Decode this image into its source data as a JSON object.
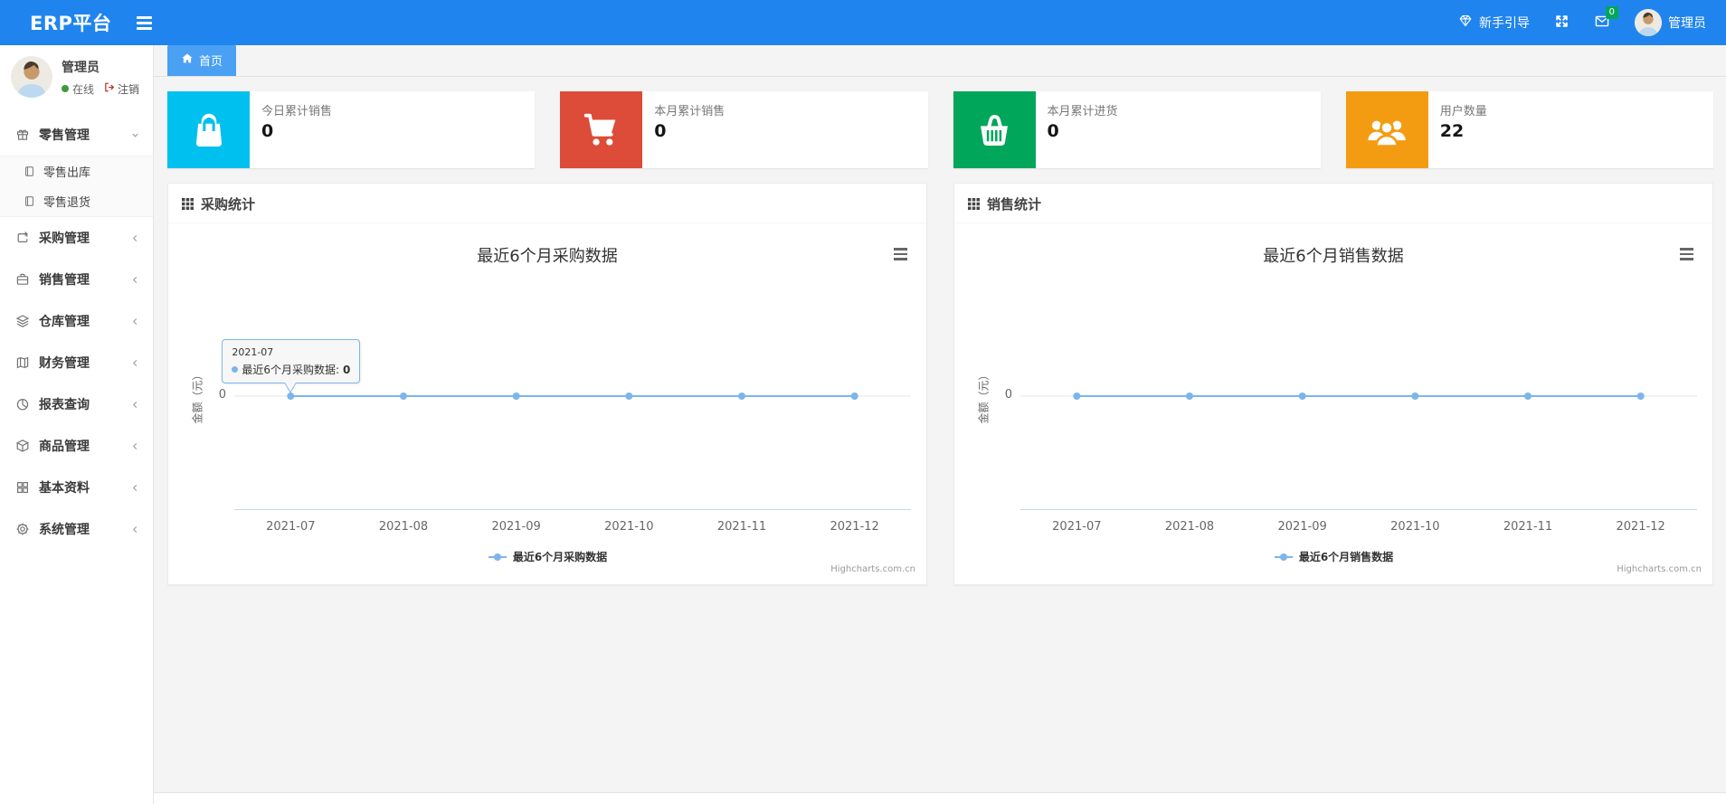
{
  "theme": {
    "navbar_bg": "#2084ef",
    "active_tab_bg": "#4aa0f2",
    "content_bg": "#f4f4f4"
  },
  "navbar": {
    "brand": "ERP平台",
    "guide_label": "新手引导",
    "messages_badge": "0",
    "user_name": "管理员"
  },
  "sidebar": {
    "user": {
      "name": "管理员",
      "status": "在线",
      "logout_label": "注销"
    },
    "items": [
      {
        "label": "零售管理",
        "children": [
          "零售出库",
          "零售退货"
        ]
      },
      {
        "label": "采购管理"
      },
      {
        "label": "销售管理"
      },
      {
        "label": "仓库管理"
      },
      {
        "label": "财务管理"
      },
      {
        "label": "报表查询"
      },
      {
        "label": "商品管理"
      },
      {
        "label": "基本资料"
      },
      {
        "label": "系统管理"
      }
    ]
  },
  "tabs": {
    "home": "首页"
  },
  "stats": [
    {
      "label": "今日累计销售",
      "value": "0",
      "color": "#00c0ef",
      "icon": "shopping-bag-icon"
    },
    {
      "label": "本月累计销售",
      "value": "0",
      "color": "#dd4b39",
      "icon": "shopping-cart-icon"
    },
    {
      "label": "本月累计进货",
      "value": "0",
      "color": "#00a65a",
      "icon": "shopping-basket-icon"
    },
    {
      "label": "用户数量",
      "value": "22",
      "color": "#f39c12",
      "icon": "users-icon"
    }
  ],
  "panels": [
    {
      "title": "采购统计"
    },
    {
      "title": "销售统计"
    }
  ],
  "chart_data": [
    {
      "type": "line",
      "title": "最近6个月采购数据",
      "categories": [
        "2021-07",
        "2021-08",
        "2021-09",
        "2021-10",
        "2021-11",
        "2021-12"
      ],
      "series": [
        {
          "name": "最近6个月采购数据",
          "values": [
            0,
            0,
            0,
            0,
            0,
            0
          ]
        }
      ],
      "xlabel": "",
      "ylabel": "金额（元）",
      "ylim": [
        -1,
        1
      ],
      "yticks": [
        0
      ],
      "series_color": "#7cb5ec",
      "legend_position": "bottom-center",
      "grid": true,
      "credits": "Highcharts.com.cn",
      "tooltip": {
        "visible": true,
        "header": "2021-07",
        "label": "最近6个月采购数据",
        "value": "0"
      }
    },
    {
      "type": "line",
      "title": "最近6个月销售数据",
      "categories": [
        "2021-07",
        "2021-08",
        "2021-09",
        "2021-10",
        "2021-11",
        "2021-12"
      ],
      "series": [
        {
          "name": "最近6个月销售数据",
          "values": [
            0,
            0,
            0,
            0,
            0,
            0
          ]
        }
      ],
      "xlabel": "",
      "ylabel": "金额（元）",
      "ylim": [
        -1,
        1
      ],
      "yticks": [
        0
      ],
      "series_color": "#7cb5ec",
      "legend_position": "bottom-center",
      "grid": true,
      "credits": "Highcharts.com.cn",
      "tooltip": {
        "visible": false
      }
    }
  ]
}
